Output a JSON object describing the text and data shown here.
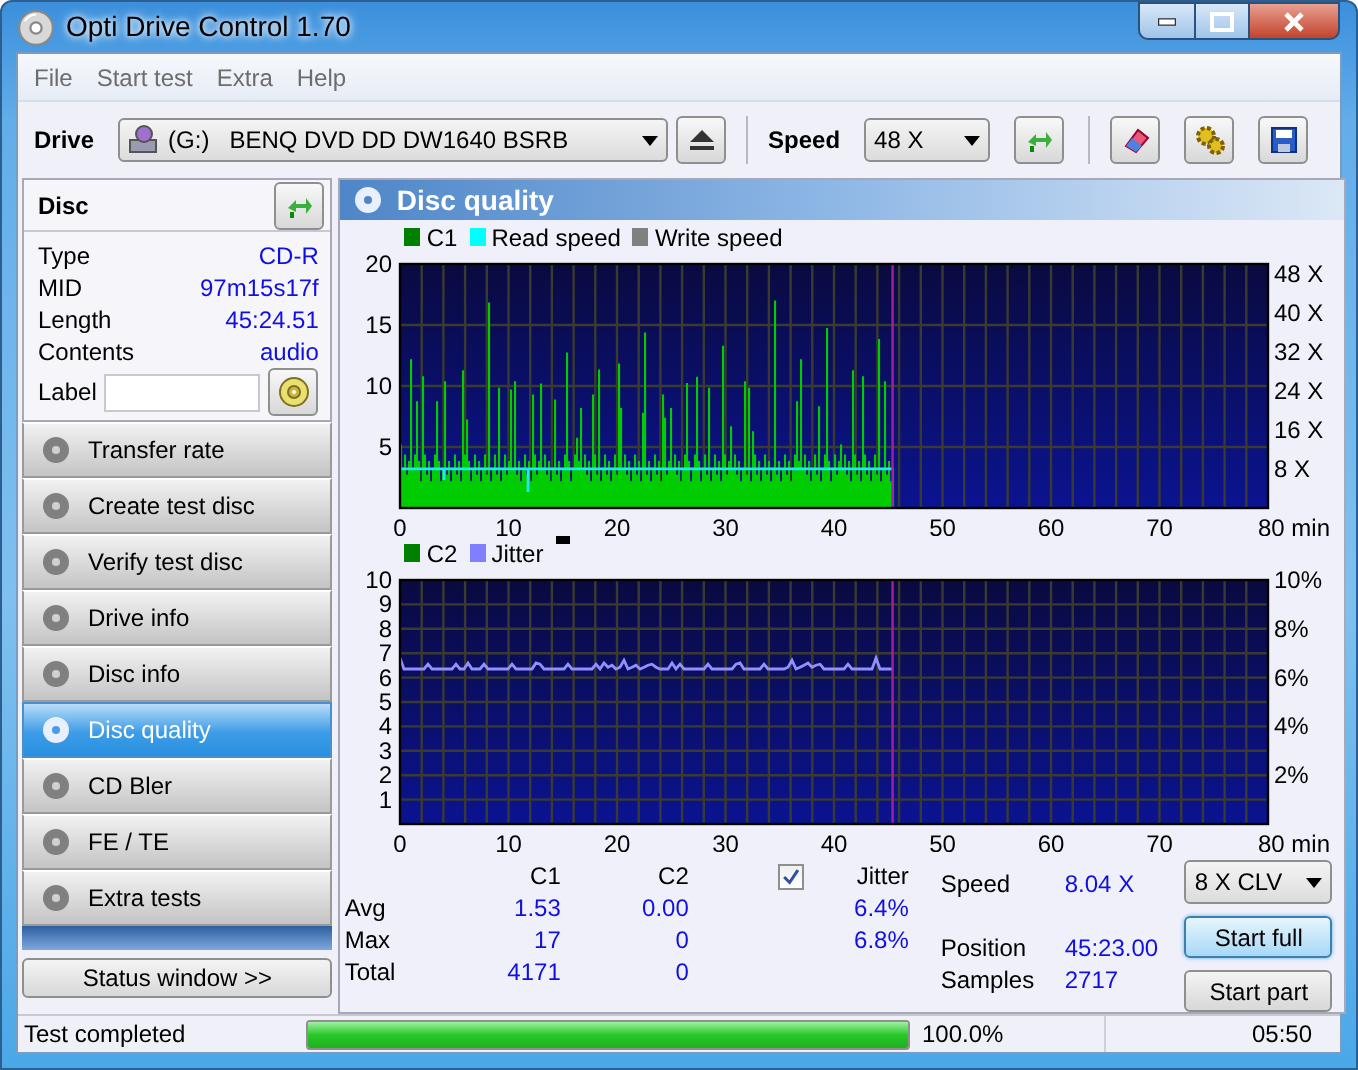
{
  "window": {
    "title": "Opti Drive Control 1.70"
  },
  "menu": [
    "File",
    "Start test",
    "Extra",
    "Help"
  ],
  "toolbar": {
    "drive_label": "Drive",
    "drive": "(G:)   BENQ DVD DD DW1640 BSRB",
    "speed_label": "Speed",
    "speed": "48 X"
  },
  "disc": {
    "title": "Disc",
    "fields": [
      {
        "label": "Type",
        "value": "CD-R"
      },
      {
        "label": "MID",
        "value": "97m15s17f"
      },
      {
        "label": "Length",
        "value": "45:24.51"
      },
      {
        "label": "Contents",
        "value": "audio"
      }
    ],
    "label_caption": "Label"
  },
  "nav": [
    {
      "label": "Transfer rate",
      "selected": false
    },
    {
      "label": "Create test disc",
      "selected": false
    },
    {
      "label": "Verify test disc",
      "selected": false
    },
    {
      "label": "Drive info",
      "selected": false
    },
    {
      "label": "Disc info",
      "selected": false
    },
    {
      "label": "Disc quality",
      "selected": true
    },
    {
      "label": "CD Bler",
      "selected": false
    },
    {
      "label": "FE / TE",
      "selected": false
    },
    {
      "label": "Extra tests",
      "selected": false
    }
  ],
  "status_window_button": "Status window >>",
  "panel": {
    "title": "Disc quality",
    "charts": [
      {
        "legend": [
          {
            "name": "C1",
            "color": "#008000"
          },
          {
            "name": "Read speed",
            "color": "#00ffff"
          },
          {
            "name": "Write speed",
            "color": "#808080"
          }
        ],
        "y_labels": [
          "20",
          "15",
          "10",
          "5"
        ],
        "right_labels": [
          "48 X",
          "40 X",
          "32 X",
          "24 X",
          "16 X",
          "8 X"
        ],
        "x_labels": [
          "0",
          "10",
          "20",
          "30",
          "40",
          "50",
          "60",
          "70",
          "80 min"
        ]
      },
      {
        "legend": [
          {
            "name": "C2",
            "color": "#008000"
          },
          {
            "name": "Jitter",
            "color": "#8080ff"
          }
        ],
        "y_labels": [
          "10",
          "9",
          "8",
          "7",
          "6",
          "5",
          "4",
          "3",
          "2",
          "1"
        ],
        "right_labels": [
          "10%",
          "8%",
          "6%",
          "4%",
          "2%"
        ],
        "x_labels": [
          "0",
          "10",
          "20",
          "30",
          "40",
          "50",
          "60",
          "70",
          "80 min"
        ]
      }
    ]
  },
  "stats": {
    "columns": [
      "C1",
      "C2"
    ],
    "jitter": {
      "label": "Jitter",
      "checked": true
    },
    "rows": [
      {
        "label": "Avg",
        "values": [
          "1.53",
          "0.00"
        ],
        "jitter": "6.4%"
      },
      {
        "label": "Max",
        "values": [
          "17",
          "0"
        ],
        "jitter": "6.8%"
      },
      {
        "label": "Total",
        "values": [
          "4171",
          "0"
        ]
      }
    ],
    "info": [
      {
        "label": "Speed",
        "value": "8.04 X"
      },
      {
        "label": "Position",
        "value": "45:23.00"
      },
      {
        "label": "Samples",
        "value": "2717"
      }
    ],
    "mode": "8 X CLV",
    "buttons": [
      {
        "label": "Start full",
        "focused": true
      },
      {
        "label": "Start part",
        "focused": false
      }
    ]
  },
  "status_bar": {
    "message": "Test completed",
    "level": 1.0,
    "percent": "100.0%",
    "time": "05:50"
  }
}
